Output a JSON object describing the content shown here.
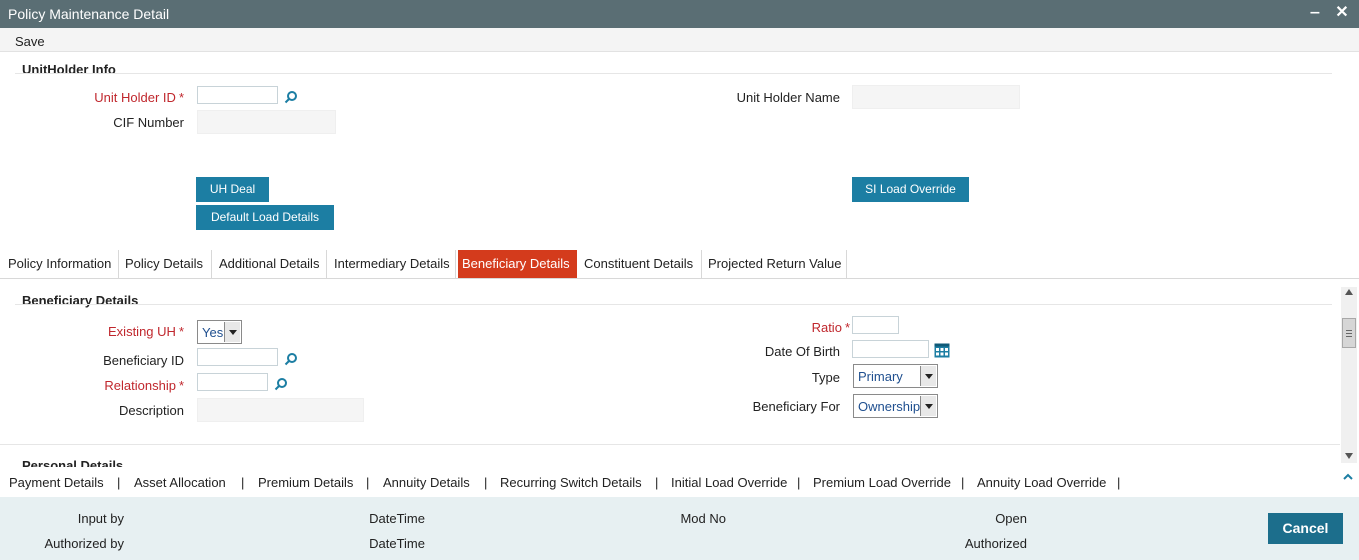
{
  "window": {
    "title": "Policy Maintenance Detail",
    "minimize_label": "‒",
    "close_label": "✕"
  },
  "menu": {
    "save_label": "Save"
  },
  "unitholder": {
    "section_title": "UnitHolder Info",
    "unit_holder_id_label": "Unit Holder ID",
    "unit_holder_id_value": "",
    "unit_holder_name_label": "Unit Holder Name",
    "unit_holder_name_value": "",
    "cif_number_label": "CIF Number",
    "cif_number_value": "",
    "uh_deal_button": "UH Deal",
    "default_load_button": "Default Load Details",
    "si_load_override_button": "SI Load Override"
  },
  "tabs": [
    {
      "label": "Policy Information"
    },
    {
      "label": "Policy Details"
    },
    {
      "label": "Additional Details"
    },
    {
      "label": "Intermediary Details"
    },
    {
      "label": "Beneficiary Details"
    },
    {
      "label": "Constituent Details"
    },
    {
      "label": "Projected Return Value"
    }
  ],
  "beneficiary": {
    "section_title": "Beneficiary Details",
    "existing_uh_label": "Existing UH",
    "existing_uh_value": "Yes",
    "beneficiary_id_label": "Beneficiary ID",
    "relationship_label": "Relationship",
    "description_label": "Description",
    "ratio_label": "Ratio",
    "date_of_birth_label": "Date Of Birth",
    "type_label": "Type",
    "type_value": "Primary",
    "beneficiary_for_label": "Beneficiary For",
    "beneficiary_for_value": "Ownership",
    "personal_details_title": "Personal Details"
  },
  "bottom_links": [
    "Payment Details",
    "Asset Allocation",
    "Premium Details",
    "Annuity Details",
    "Recurring Switch Details",
    "Initial Load Override",
    "Premium Load Override",
    "Annuity Load Override"
  ],
  "footer": {
    "input_by": "Input by",
    "authorized_by": "Authorized by",
    "datetime1": "DateTime",
    "datetime2": "DateTime",
    "mod_no": "Mod No",
    "open": "Open",
    "authorized": "Authorized",
    "cancel_label": "Cancel"
  },
  "colors": {
    "titlebar": "#5a6e74",
    "active_tab": "#d43b1c",
    "button": "#1c7ea3",
    "required_label": "#c0272d",
    "footer_bg": "#e7f0f2"
  },
  "icons": {
    "lookup": "search-icon",
    "calendar": "calendar-icon",
    "dropdown": "chevron-down-icon"
  }
}
